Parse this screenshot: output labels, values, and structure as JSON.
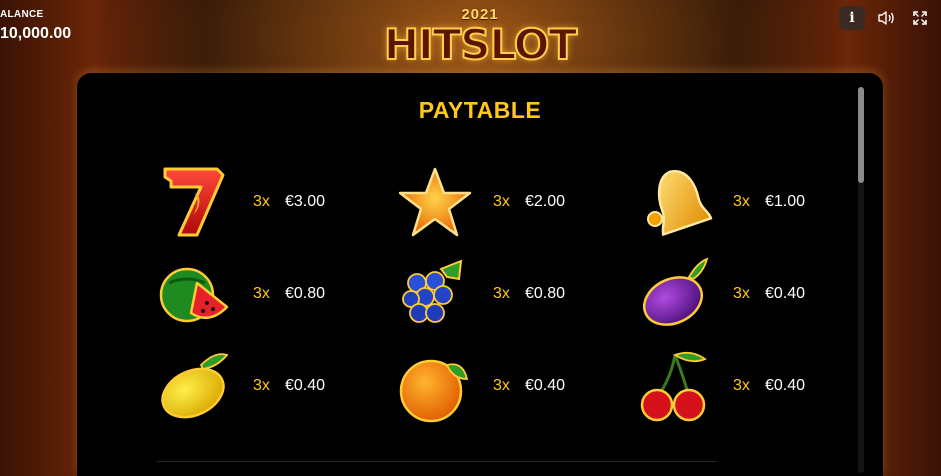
{
  "header": {
    "balance_label": "ALANCE",
    "balance_value": "10,000.00",
    "logo_year": "2021",
    "logo_text": "HITSLOT",
    "icons": [
      "info-icon",
      "sound-icon",
      "fullscreen-icon"
    ],
    "info_glyph": "i"
  },
  "paytable": {
    "title": "PAYTABLE",
    "items": [
      {
        "symbol": "seven",
        "multiplier": "3x",
        "payout": "€3.00"
      },
      {
        "symbol": "star",
        "multiplier": "3x",
        "payout": "€2.00"
      },
      {
        "symbol": "bell",
        "multiplier": "3x",
        "payout": "€1.00"
      },
      {
        "symbol": "watermelon",
        "multiplier": "3x",
        "payout": "€0.80"
      },
      {
        "symbol": "grapes",
        "multiplier": "3x",
        "payout": "€0.80"
      },
      {
        "symbol": "plum",
        "multiplier": "3x",
        "payout": "€0.40"
      },
      {
        "symbol": "lemon",
        "multiplier": "3x",
        "payout": "€0.40"
      },
      {
        "symbol": "orange",
        "multiplier": "3x",
        "payout": "€0.40"
      },
      {
        "symbol": "cherries",
        "multiplier": "3x",
        "payout": "€0.40"
      }
    ]
  },
  "colors": {
    "accent": "#ffc71a",
    "panel": "#000000",
    "text": "#ffffff"
  }
}
